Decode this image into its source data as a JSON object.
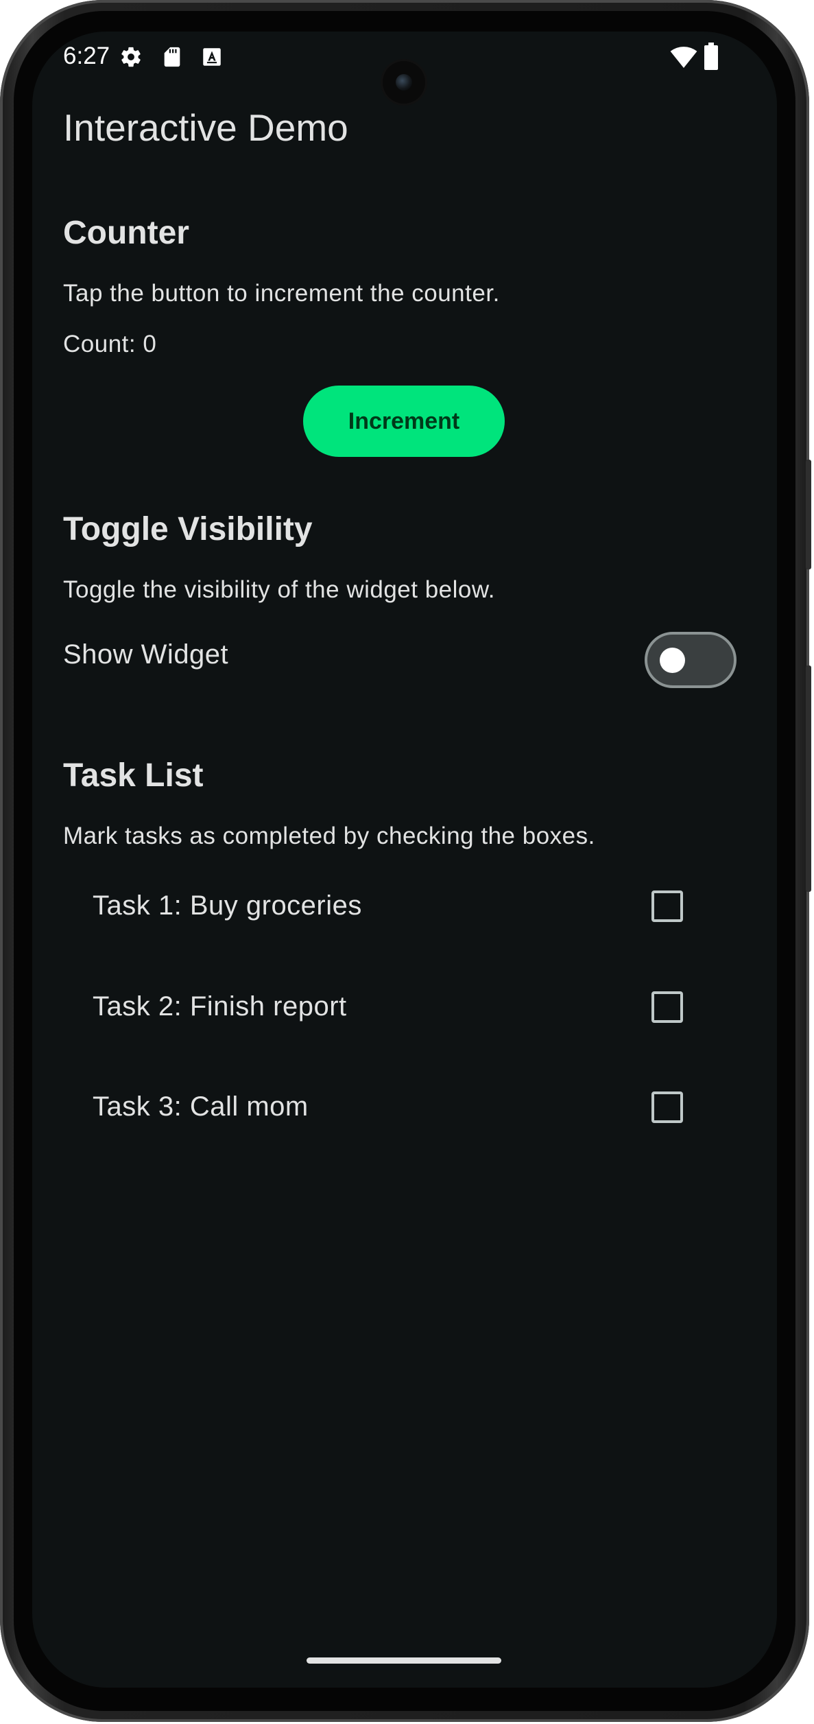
{
  "status_bar": {
    "time": "6:27",
    "icons": [
      "gear-icon",
      "sd-card-icon",
      "keyboard-a-icon",
      "wifi-icon",
      "battery-icon"
    ]
  },
  "app": {
    "title": "Interactive Demo"
  },
  "counter": {
    "title": "Counter",
    "description": "Tap the button to increment the counter.",
    "count_text": "Count: 0",
    "button_label": "Increment"
  },
  "toggle": {
    "title": "Toggle Visibility",
    "description": "Toggle the visibility of the widget below.",
    "switch_label": "Show Widget",
    "switch_on": false
  },
  "tasks": {
    "title": "Task List",
    "description": "Mark tasks as completed by checking the boxes.",
    "items": [
      {
        "label": "Task 1: Buy groceries",
        "checked": false
      },
      {
        "label": "Task 2: Finish report",
        "checked": false
      },
      {
        "label": "Task 3: Call mom",
        "checked": false
      }
    ]
  },
  "colors": {
    "background": "#0e1213",
    "accent": "#00e47c",
    "text": "#e2e3e3"
  }
}
